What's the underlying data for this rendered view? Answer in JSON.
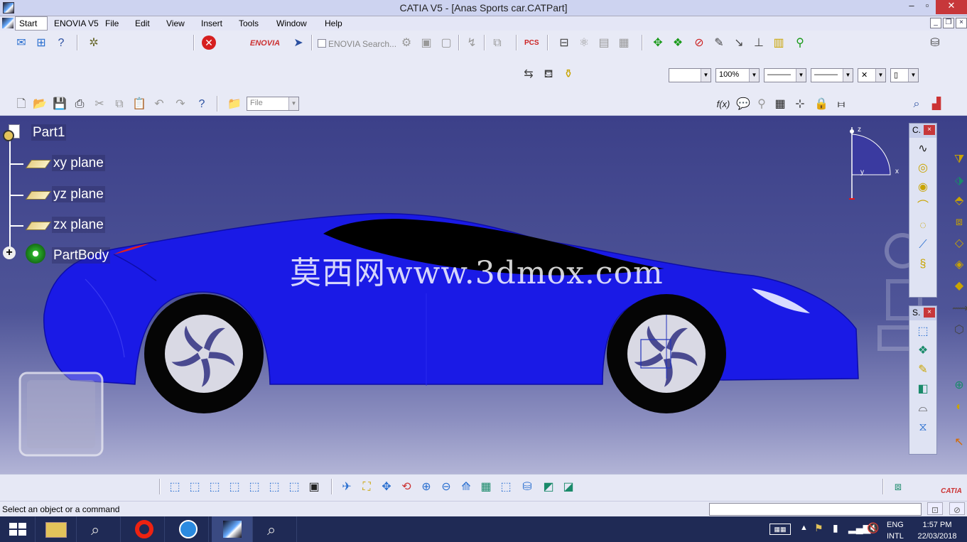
{
  "window": {
    "title": "CATIA V5 - [Anas Sports car.CATPart]",
    "minimize": "–",
    "restore": "▫",
    "close": "✕"
  },
  "menu": {
    "items": [
      "Start",
      "ENOVIA V5",
      "File",
      "Edit",
      "View",
      "Insert",
      "Tools",
      "Window",
      "Help"
    ]
  },
  "toolbar": {
    "enovia_search_label": "ENOVIA Search...",
    "zoom_value": "100%",
    "file_combo_value": "File"
  },
  "spec_tree": {
    "root": "Part1",
    "items": [
      "xy plane",
      "yz plane",
      "zx plane",
      "PartBody"
    ]
  },
  "compass": {
    "z_label": "z",
    "y_label": "y",
    "x_label": "x"
  },
  "palettes": {
    "curves_title": "C.",
    "surfaces_title": "S."
  },
  "watermark": "莫西网www.3dmox.com",
  "colors": {
    "car_body": "#1a1ae6",
    "viewport_top": "#3c4089",
    "accent_close": "#c7373a"
  },
  "status": {
    "message": "Select an object or a command",
    "command_input": ""
  },
  "taskbar": {
    "language": "ENG",
    "layout": "INTL",
    "time": "1:57 PM",
    "date": "22/03/2018"
  }
}
